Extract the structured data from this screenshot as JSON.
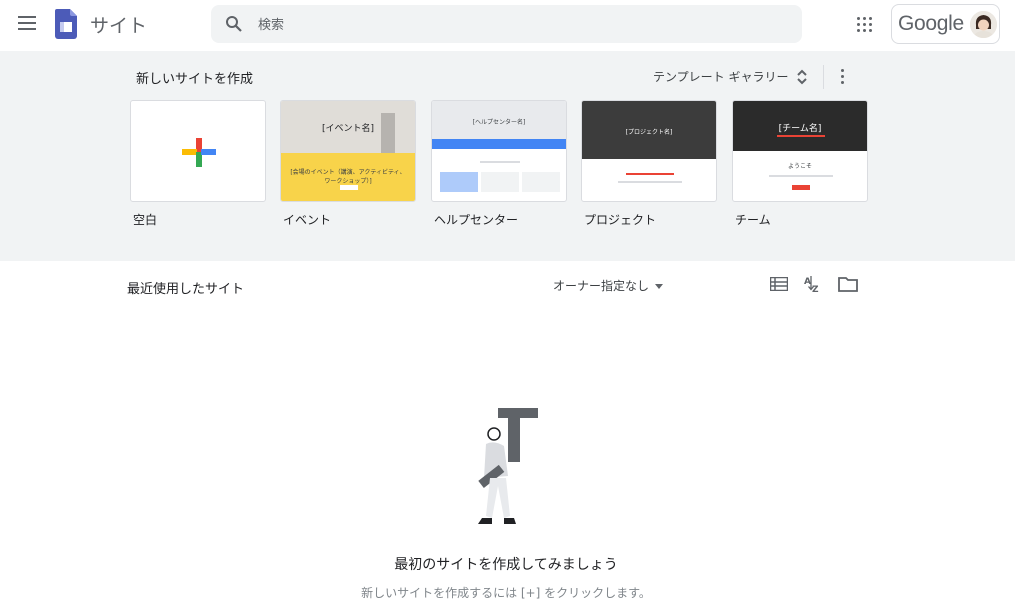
{
  "header": {
    "app_name": "サイト",
    "search_placeholder": "検索",
    "google_label": "Google"
  },
  "templates": {
    "title": "新しいサイトを作成",
    "gallery_label": "テンプレート ギャラリー",
    "items": [
      {
        "label": "空白"
      },
      {
        "label": "イベント",
        "thumb_title": "[イベント名]",
        "thumb_text": "[会場のイベント（講演、アクティビティ、ワークショップ）]"
      },
      {
        "label": "ヘルプセンター",
        "thumb_title": "[ヘルプセンター名]"
      },
      {
        "label": "プロジェクト",
        "thumb_title": "[プロジェクト名]"
      },
      {
        "label": "チーム",
        "thumb_title": "[チーム名]",
        "thumb_text": "ようこそ"
      }
    ]
  },
  "recent": {
    "title": "最近使用したサイト",
    "owner_filter": "オーナー指定なし"
  },
  "empty": {
    "title": "最初のサイトを作成してみましょう",
    "subtitle": "新しいサイトを作成するには [+] をクリックします。"
  },
  "colors": {
    "accent_blue": "#4285f4",
    "red": "#ea4335",
    "yellow": "#fbbc04",
    "green": "#34a853",
    "sites_purple": "#4c5bb8",
    "panel_bg": "#f1f3f4"
  },
  "icons": [
    "menu-icon",
    "sites-logo-icon",
    "search-icon",
    "apps-icon",
    "avatar",
    "unfold-icon",
    "more-vert-icon",
    "plus-icon",
    "list-view-icon",
    "sort-az-icon",
    "folder-icon"
  ]
}
